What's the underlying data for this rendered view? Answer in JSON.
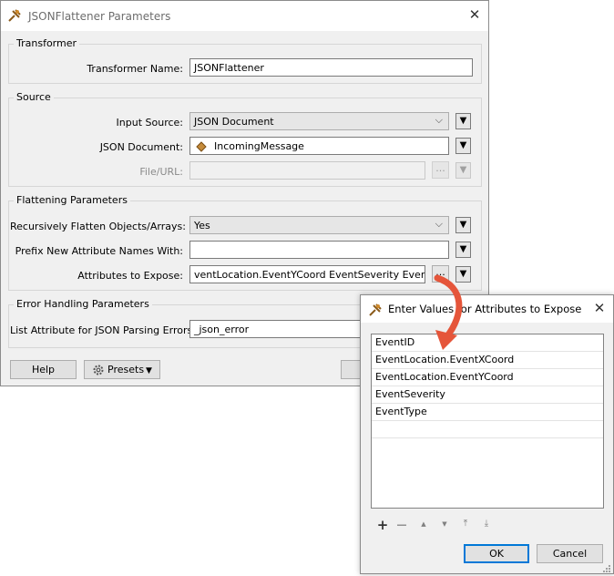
{
  "main_dialog": {
    "title": "JSONFlattener Parameters",
    "close_glyph": "✕",
    "app_icon": "fme-transformer-icon",
    "transformer": {
      "group_label": "Transformer",
      "name_label": "Transformer Name:",
      "name_value": "JSONFlattener"
    },
    "source": {
      "group_label": "Source",
      "input_source_label": "Input Source:",
      "input_source_value": "JSON Document",
      "json_document_label": "JSON Document:",
      "json_document_value": "IncomingMessage",
      "file_url_label": "File/URL:",
      "file_url_value": ""
    },
    "flattening": {
      "group_label": "Flattening Parameters",
      "recursive_label": "Recursively Flatten Objects/Arrays:",
      "recursive_value": "Yes",
      "prefix_label": "Prefix New Attribute Names With:",
      "prefix_value": "",
      "attributes_label": "Attributes to Expose:",
      "attributes_value": "ventLocation.EventYCoord EventSeverity EventType"
    },
    "error_handling": {
      "group_label": "Error Handling Parameters",
      "list_attr_label": "List Attribute for JSON Parsing Errors:",
      "list_attr_value": "_json_error"
    },
    "buttons": {
      "help": "Help",
      "presets": "Presets"
    },
    "ellipsis": "...",
    "dropdown_glyph": "▼",
    "chevron_glyph": "⌵"
  },
  "expose_dialog": {
    "title": "Enter Values for Attributes to Expose",
    "close_glyph": "✕",
    "items": [
      "EventID",
      "EventLocation.EventXCoord",
      "EventLocation.EventYCoord",
      "EventSeverity",
      "EventType",
      ""
    ],
    "toolbar": {
      "add": "+",
      "remove": "—",
      "move_up": "▲",
      "move_down": "▼",
      "move_top": "⤒",
      "move_bottom": "⤓"
    },
    "ok": "OK",
    "cancel": "Cancel"
  },
  "colors": {
    "accent": "#0078d7",
    "arrow": "#e5553a",
    "window_bg": "#f0f0f0"
  }
}
